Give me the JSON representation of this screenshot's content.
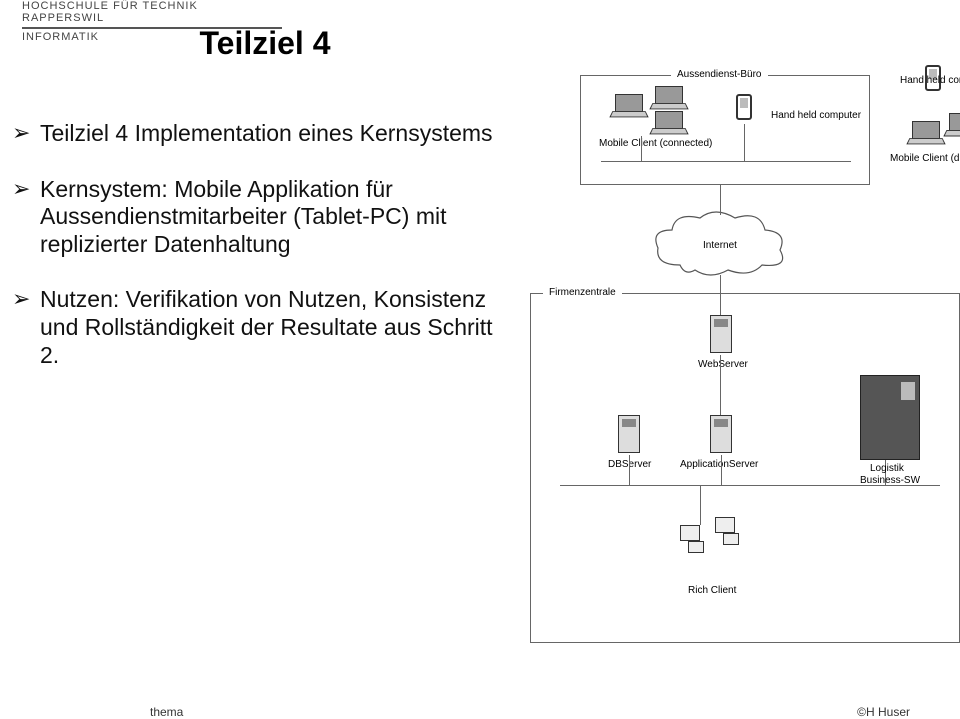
{
  "header": {
    "line1": "HOCHSCHULE FÜR TECHNIK",
    "line2": "RAPPERSWIL",
    "line3": "INFORMATIK"
  },
  "title": "Teilziel 4",
  "bullets": [
    "Teilziel 4 Implementation eines Kernsystems",
    "Kernsystem: Mobile Applikation für Aussendienstmitarbeiter (Tablet-PC) mit replizierter Datenhaltung",
    "Nutzen: Verifikation von Nutzen, Konsistenz und Rollständigkeit der Resultate aus Schritt 2."
  ],
  "diagram": {
    "box_aussen": "Aussendienst-Büro",
    "box_firmen": "Firmenzentrale",
    "mobile_connected": "Mobile Client (connected)",
    "handheld1": "Hand held computer",
    "handheld2": "Hand held computer",
    "mobile_disconn": "Mobile Client (disconne",
    "internet": "Internet",
    "webserver": "WebServer",
    "dbserver": "DBServer",
    "appserver": "ApplicationServer",
    "logistik1": "Logistik",
    "logistik2": "Business-SW",
    "richclient": "Rich Client"
  },
  "footer": {
    "left": "thema",
    "right": "©H Huser"
  }
}
